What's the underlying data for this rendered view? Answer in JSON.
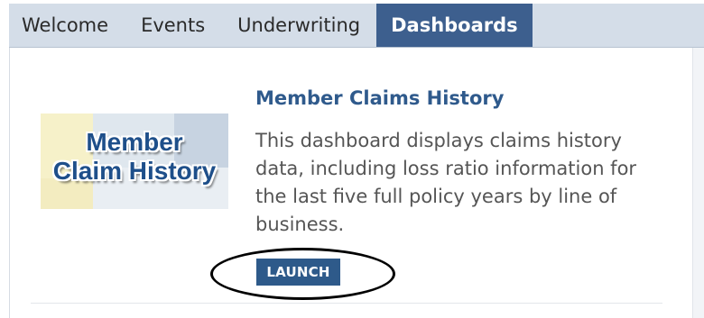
{
  "tabs": [
    {
      "label": "Welcome",
      "active": false
    },
    {
      "label": "Events",
      "active": false
    },
    {
      "label": "Underwriting",
      "active": false
    },
    {
      "label": "Dashboards",
      "active": true
    }
  ],
  "dashboard": {
    "thumbnail_text_line1": "Member",
    "thumbnail_text_line2": "Claim History",
    "title": "Member Claims History",
    "description": "This dashboard displays claims history data, including loss ratio information for the last five full policy years by line of business.",
    "launch_label": "LAUNCH"
  },
  "colors": {
    "tabbar_bg": "#d4dde8",
    "active_tab_bg": "#3d5f8e",
    "title": "#2f5a8c",
    "button_bg": "#2e5a8a"
  }
}
